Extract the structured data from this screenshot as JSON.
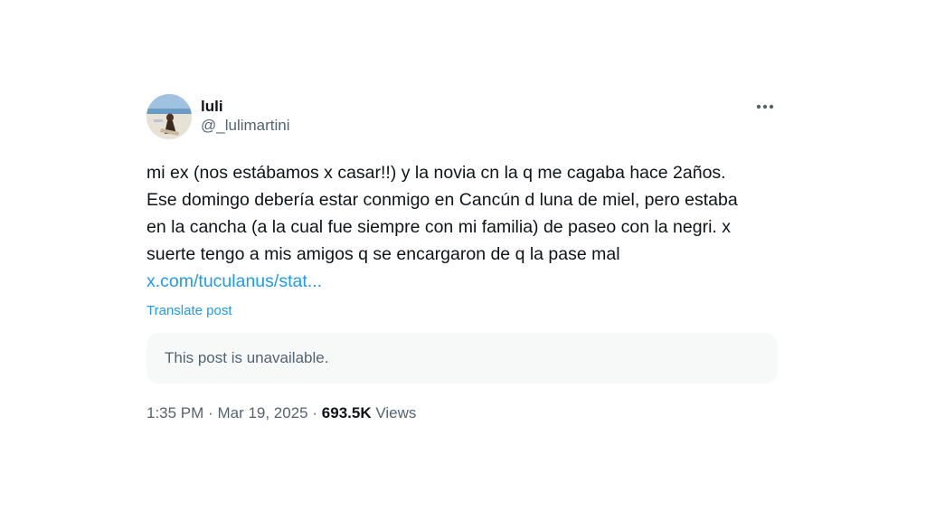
{
  "author": {
    "display_name": "luli",
    "handle": "@_lulimartini",
    "avatar_icon": "profile-photo-avatar"
  },
  "more_icon": "more-horizontal-icon",
  "post": {
    "lines": [
      "mi ex (nos estábamos x casar!!) y la novia cn la q me cagaba hace 2años.",
      "Ese domingo debería estar conmigo en Cancún d luna de miel, pero estaba",
      "en la cancha (a la cual fue siempre con mi familia) de paseo con la negri. x",
      "suerte tengo a mis amigos q se encargaron de q la pase mal"
    ],
    "link": "x.com/tuculanus/stat...",
    "translate_label": "Translate post"
  },
  "quoted": {
    "message": "This post is unavailable."
  },
  "meta": {
    "time": "1:35 PM",
    "separator": "·",
    "date": "Mar 19, 2025",
    "views_count": "693.5K",
    "views_label": "Views"
  },
  "colors": {
    "text": "#0f1419",
    "secondary": "#536471",
    "link": "#1d9bf0",
    "card_bg": "#f7f9f9"
  }
}
